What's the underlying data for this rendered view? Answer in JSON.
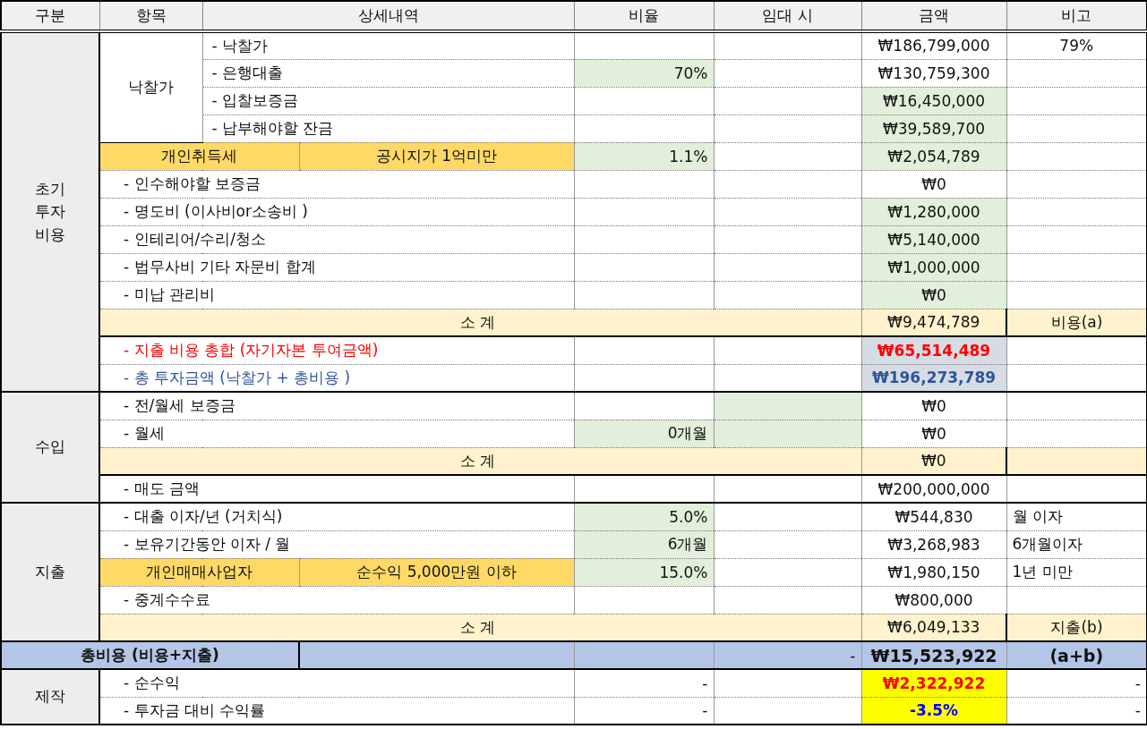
{
  "columns": [
    "구분",
    "항목",
    "상세내역",
    "비율",
    "임대 시",
    "금액",
    "비고"
  ],
  "blocks": [
    {
      "kind": "section",
      "label": "초기 투자 비용",
      "rows": [
        {
          "kind": "group",
          "label": "낙찰가",
          "rows": [
            {
              "kind": "item",
              "detail": "- 낙찰가",
              "amount": "₩186,799,000",
              "note": {
                "text": "79%",
                "kind": "center"
              }
            },
            {
              "kind": "item",
              "detail": "- 은행대출",
              "ratio": "70%",
              "ratio_input": true,
              "amount": "₩130,759,300"
            },
            {
              "kind": "item",
              "detail": "- 입찰보증금",
              "amount": "₩16,450,000",
              "amount_input": true
            },
            {
              "kind": "item",
              "detail": "- 납부해야할 잔금",
              "amount": "₩39,589,700",
              "amount_input": true
            }
          ]
        },
        {
          "kind": "tax",
          "detail": "개인취득세",
          "condition": "공시지가 1억미만",
          "ratio": "1.1%",
          "ratio_input": true,
          "amount": "₩2,054,789",
          "amount_input": true
        },
        {
          "kind": "item",
          "detail": "- 인수해야할 보증금",
          "amount": "₩0",
          "amount_input": false
        },
        {
          "kind": "item",
          "detail": "- 명도비 (이사비or소송비 )",
          "amount": "₩1,280,000",
          "amount_input": true
        },
        {
          "kind": "item",
          "detail": "- 인테리어/수리/청소",
          "amount": "₩5,140,000",
          "amount_input": true
        },
        {
          "kind": "item",
          "detail": "- 법무사비 기타 자문비 합계",
          "amount": "₩1,000,000",
          "amount_input": true
        },
        {
          "kind": "item",
          "detail": "- 미납 관리비",
          "amount": "₩0",
          "amount_input": true
        },
        {
          "kind": "subtotal",
          "detail": "소 계",
          "amount": "₩9,474,789",
          "note": {
            "text": "비용(a)",
            "kind": "center"
          }
        },
        {
          "kind": "expense",
          "detail": "- 지출 비용 총합 (자기자본 투여금액)",
          "amount": "₩65,514,489"
        },
        {
          "kind": "investment",
          "detail": "- 총 투자금액 (낙찰가 + 총비용 )",
          "amount": "₩196,273,789"
        }
      ]
    },
    {
      "kind": "section",
      "label": "수입",
      "rows": [
        {
          "kind": "item",
          "detail": "- 전/월세 보증금",
          "rental_input": true,
          "amount": "₩0"
        },
        {
          "kind": "item",
          "detail": "- 월세",
          "ratio": "0개월",
          "ratio_input": true,
          "rental_input": true,
          "amount": "₩0"
        },
        {
          "kind": "subtotal",
          "detail": "소 계",
          "amount": "₩0"
        },
        {
          "kind": "item",
          "detail": "- 매도 금액",
          "amount": "₩200,000,000"
        }
      ]
    },
    {
      "kind": "section",
      "label": "지출",
      "rows": [
        {
          "kind": "item",
          "detail": "- 대출 이자/년 (거치식)",
          "ratio": "5.0%",
          "ratio_input": true,
          "amount": "₩544,830",
          "note": {
            "text": "월 이자",
            "kind": "left"
          }
        },
        {
          "kind": "item",
          "detail": "- 보유기간동안 이자 / 월",
          "ratio": "6개월",
          "ratio_input": true,
          "amount": "₩3,268,983",
          "note": {
            "text": "6개월이자",
            "kind": "left"
          }
        },
        {
          "kind": "tax",
          "detail": "개인매매사업자",
          "condition": "순수익 5,000만원 이하",
          "ratio": "15.0%",
          "ratio_input": true,
          "amount": "₩1,980,150",
          "note": {
            "text": "1년 미만",
            "kind": "left"
          }
        },
        {
          "kind": "item",
          "detail": "- 중계수수료",
          "amount": "₩800,000"
        },
        {
          "kind": "subtotal",
          "detail": "소 계",
          "amount": "₩6,049,133",
          "note": {
            "text": "지출(b)",
            "kind": "center"
          }
        }
      ]
    },
    {
      "kind": "total",
      "label": "총비용 (비용+지출)",
      "rental": "-",
      "amount": "₩15,523,922",
      "note": "(a+b)"
    },
    {
      "kind": "section",
      "label": "제작",
      "rows": [
        {
          "kind": "profit",
          "detail": "- 순수익",
          "ratio": "-",
          "amount": "₩2,322,922",
          "note": {
            "text": "-",
            "kind": "right"
          }
        },
        {
          "kind": "rate",
          "detail": "- 투자금 대비 수익률",
          "ratio": "-",
          "amount": "-3.5%",
          "note": {
            "text": "-",
            "kind": "right"
          }
        }
      ]
    }
  ]
}
